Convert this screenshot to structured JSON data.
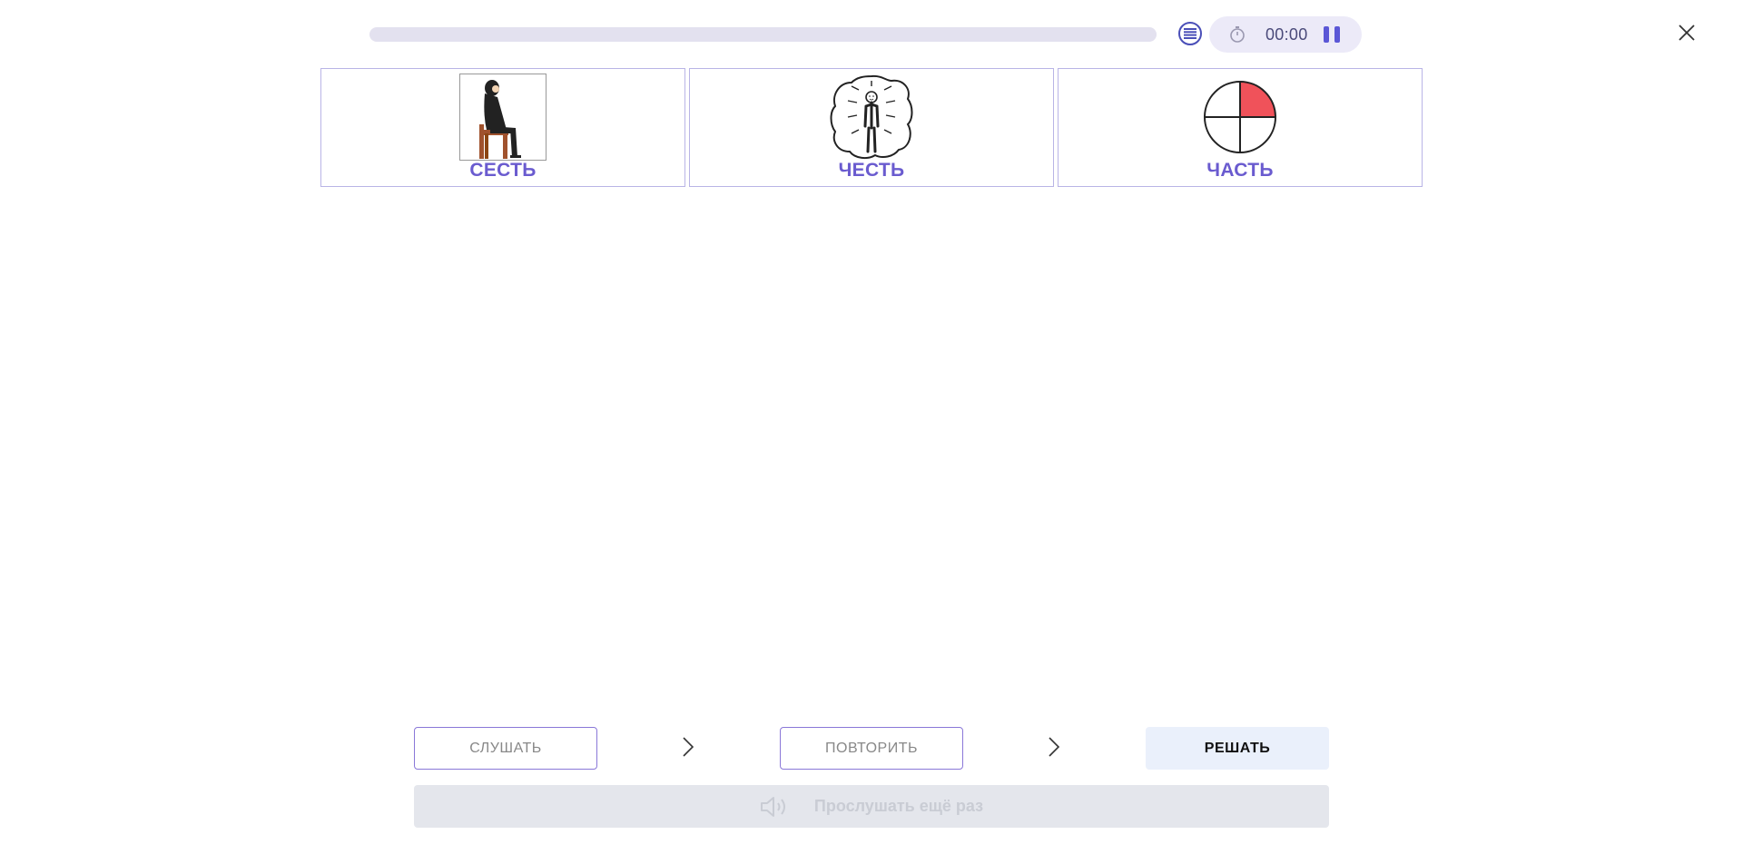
{
  "progress": {
    "fraction": 0
  },
  "timer": {
    "time": "00:00"
  },
  "cards": [
    {
      "label": "СЕСТЬ"
    },
    {
      "label": "ЧЕСТЬ"
    },
    {
      "label": "ЧАСТЬ"
    }
  ],
  "steps": {
    "listen": "СЛУШАТЬ",
    "repeat": "ПОВТОРИТЬ",
    "solve": "РЕШАТЬ"
  },
  "replay": {
    "label": "Прослушать ещё раз"
  },
  "colors": {
    "accent": "#6a5bcf",
    "card_border": "#b9b4e6",
    "pie_fill": "#f0525a",
    "chair": "#a0522d",
    "pause": "#5b57d6"
  }
}
